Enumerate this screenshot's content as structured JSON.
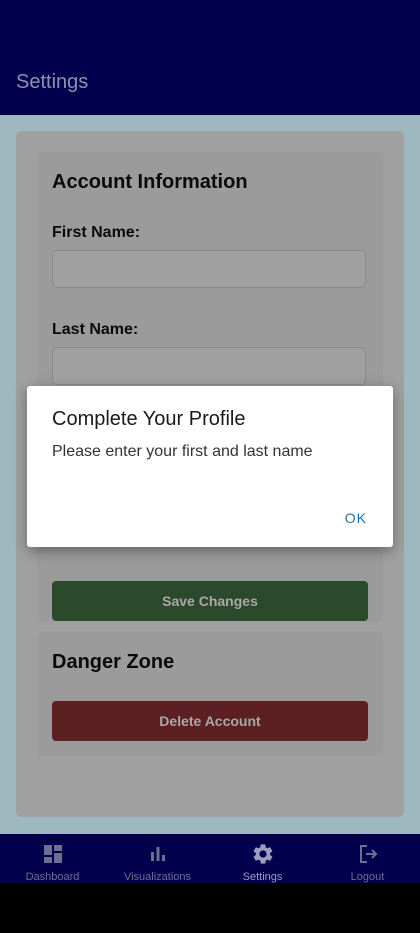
{
  "header": {
    "title": "Settings"
  },
  "account": {
    "title": "Account Information",
    "first_name_label": "First Name:",
    "first_name_value": "",
    "last_name_label": "Last Name:",
    "last_name_value": "",
    "save_label": "Save Changes"
  },
  "danger": {
    "title": "Danger Zone",
    "delete_label": "Delete Account"
  },
  "dialog": {
    "title": "Complete Your Profile",
    "message": "Please enter your first and last name",
    "ok_label": "OK"
  },
  "tabs": [
    {
      "label": "Dashboard",
      "icon": "dashboard-icon",
      "active": false
    },
    {
      "label": "Visualizations",
      "icon": "bar-chart-icon",
      "active": false
    },
    {
      "label": "Settings",
      "icon": "gear-icon",
      "active": true
    },
    {
      "label": "Logout",
      "icon": "logout-icon",
      "active": false
    }
  ],
  "colors": {
    "header_bg": "#02004c",
    "save_button": "#3d8b3d",
    "delete_button": "#d32f2f",
    "dialog_accent": "#1f6fb0"
  }
}
